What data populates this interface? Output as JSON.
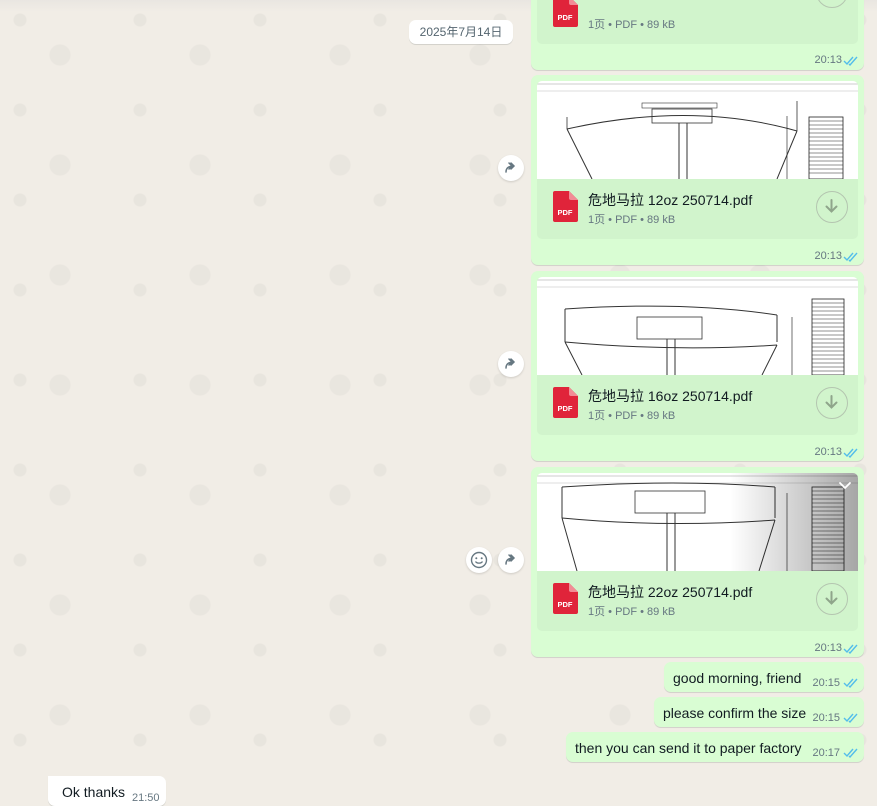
{
  "date_separator": "2025年7月14日",
  "documents": [
    {
      "file_name": "",
      "meta": "1页 • PDF • 89 kB",
      "time": "20:13",
      "pdf_badge": "PDF"
    },
    {
      "file_name": "危地马拉 12oz 250714.pdf",
      "meta": "1页 • PDF • 89 kB",
      "time": "20:13",
      "pdf_badge": "PDF"
    },
    {
      "file_name": "危地马拉 16oz 250714.pdf",
      "meta": "1页 • PDF • 89 kB",
      "time": "20:13",
      "pdf_badge": "PDF"
    },
    {
      "file_name": "危地马拉 22oz 250714.pdf",
      "meta": "1页 • PDF • 89 kB",
      "time": "20:13",
      "pdf_badge": "PDF"
    }
  ],
  "outgoing_text": [
    {
      "text": "good morning, friend",
      "time": "20:15"
    },
    {
      "text": "please confirm the size",
      "time": "20:15"
    },
    {
      "text": "then you can send it to paper factory",
      "time": "20:17"
    }
  ],
  "incoming_text": [
    {
      "text": "Ok thanks",
      "time": "21:50"
    }
  ],
  "icons": {
    "pdf": "pdf-icon",
    "download": "download-icon",
    "forward": "forward-icon",
    "emoji": "emoji-icon",
    "read_receipt": "double-check-icon",
    "menu": "chevron-down-icon"
  },
  "colors": {
    "outgoing_bubble": "#d9fdd3",
    "document_info": "#d1f4cc",
    "read_ticks": "#53bdeb",
    "pdf_red": "#e0243a",
    "background": "#efeae2"
  }
}
